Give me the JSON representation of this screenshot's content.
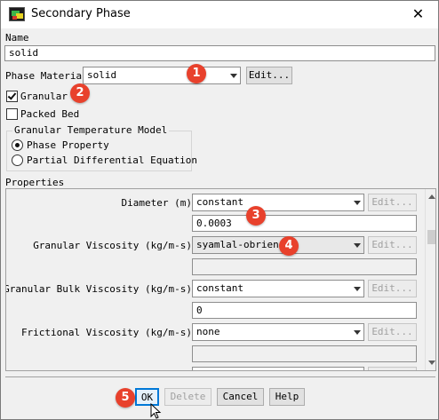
{
  "window": {
    "title": "Secondary Phase",
    "close_symbol": "✕"
  },
  "name_section": {
    "label": "Name",
    "value": "solid"
  },
  "phase_material": {
    "label": "Phase Material",
    "value": "solid",
    "edit_label": "Edit..."
  },
  "granular": {
    "label": "Granular",
    "checked": true
  },
  "packed_bed": {
    "label": "Packed Bed",
    "checked": false
  },
  "granular_temp_model": {
    "title": "Granular Temperature Model",
    "options": [
      {
        "label": "Phase Property",
        "selected": true
      },
      {
        "label": "Partial Differential Equation",
        "selected": false
      }
    ]
  },
  "properties": {
    "title": "Properties",
    "rows": [
      {
        "label": "Diameter (m)",
        "method": "constant",
        "edit_label": "Edit...",
        "value": "0.0003"
      },
      {
        "label": "Granular Viscosity (kg/m-s)",
        "method": "syamlal-obrien",
        "edit_label": "Edit...",
        "value": ""
      },
      {
        "label": "Granular Bulk Viscosity (kg/m-s)",
        "method": "constant",
        "edit_label": "Edit...",
        "value": "0"
      },
      {
        "label": "Frictional Viscosity (kg/m-s)",
        "method": "none",
        "edit_label": "Edit...",
        "value": ""
      }
    ]
  },
  "buttons": {
    "ok": "OK",
    "delete": "Delete",
    "cancel": "Cancel",
    "help": "Help"
  },
  "annotations": [
    "1",
    "2",
    "3",
    "4",
    "5"
  ],
  "colors": {
    "badge": "#e8412c",
    "focus_outline": "#0078d7"
  }
}
